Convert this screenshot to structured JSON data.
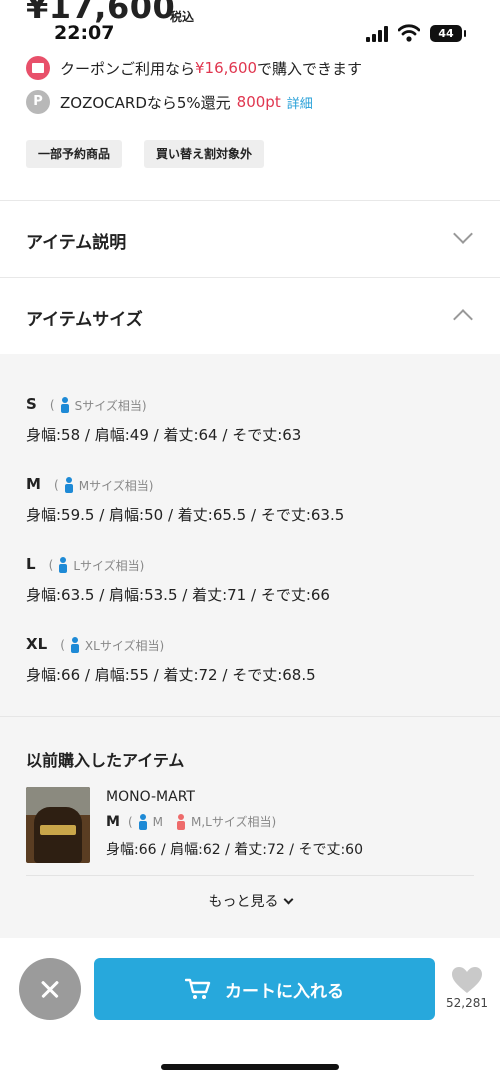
{
  "status_bar": {
    "time": "22:07",
    "battery": "44"
  },
  "price": {
    "amount": "¥17,600",
    "tax": "税込"
  },
  "coupon": {
    "prefix": "クーポンご利用なら",
    "amount": "¥16,600",
    "suffix": "で購入できます"
  },
  "zozocard": {
    "text": "ZOZOCARDなら5%還元",
    "points": "800pt",
    "detail_link": "詳細",
    "icon_letter": "P"
  },
  "tags": [
    "一部予約商品",
    "買い替え割対象外"
  ],
  "sections": {
    "description": {
      "title": "アイテム説明"
    },
    "size": {
      "title": "アイテムサイズ"
    }
  },
  "sizes": [
    {
      "label": "S",
      "hint": "Sサイズ相当)",
      "detail": "身幅:58 / 肩幅:49 / 着丈:64 / そで丈:63"
    },
    {
      "label": "M",
      "hint": "Mサイズ相当)",
      "detail": "身幅:59.5 / 肩幅:50 / 着丈:65.5 / そで丈:63.5"
    },
    {
      "label": "L",
      "hint": "Lサイズ相当)",
      "detail": "身幅:63.5 / 肩幅:53.5 / 着丈:71 / そで丈:66"
    },
    {
      "label": "XL",
      "hint": "XLサイズ相当)",
      "detail": "身幅:66 / 肩幅:55 / 着丈:72 / そで丈:68.5"
    }
  ],
  "paren_open": "(",
  "previous": {
    "title": "以前購入したアイテム",
    "brand": "MONO-MART",
    "size": "M",
    "male_hint": "M",
    "female_hint": "M,Lサイズ相当)",
    "detail": "身幅:66 / 肩幅:62 / 着丈:72 / そで丈:60",
    "more": "もっと見る"
  },
  "bottom": {
    "cart_label": "カートに入れる",
    "fav_count": "52,281"
  },
  "colors": {
    "accent": "#27a8dc",
    "sale": "#e0364f",
    "link": "#27a0d8"
  }
}
